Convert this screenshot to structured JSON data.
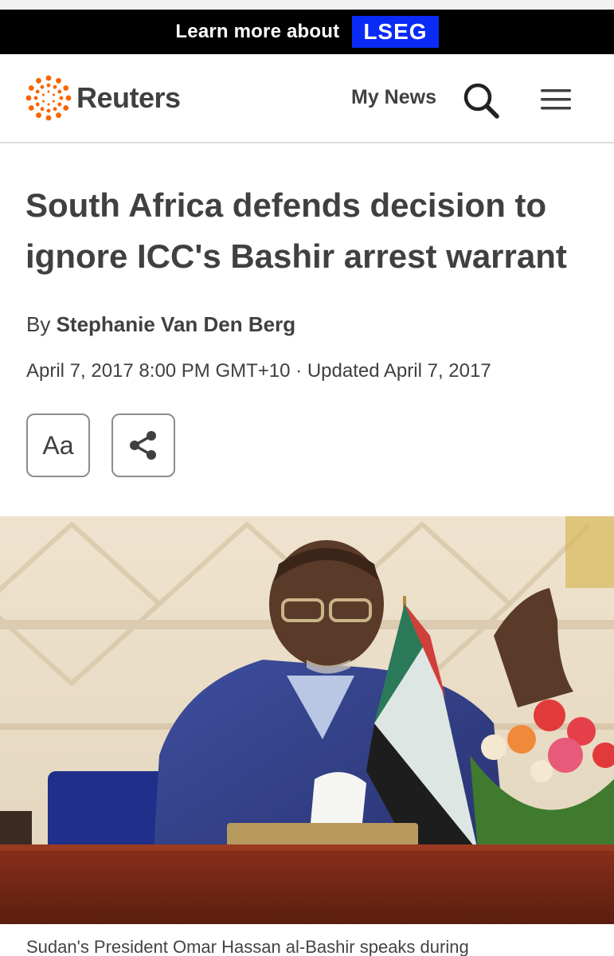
{
  "banner": {
    "text": "Learn more about",
    "brand": "LSEG",
    "brand_color": "#0a2bf5"
  },
  "header": {
    "logo_text": "Reuters",
    "logo_color": "#fa6400",
    "my_news": "My News",
    "search_icon": "search-icon",
    "menu_icon": "hamburger-menu-icon"
  },
  "article": {
    "headline": "South Africa defends decision to ignore ICC's Bashir arrest warrant",
    "by": "By",
    "author": "Stephanie Van Den Berg",
    "dateline": "April 7, 2017 8:00 PM GMT+10 · Updated April 7, 2017",
    "font_button_label": "Aa",
    "share_icon": "share-icon"
  },
  "photo": {
    "caption": "Sudan's President Omar Hassan al-Bashir speaks during"
  }
}
